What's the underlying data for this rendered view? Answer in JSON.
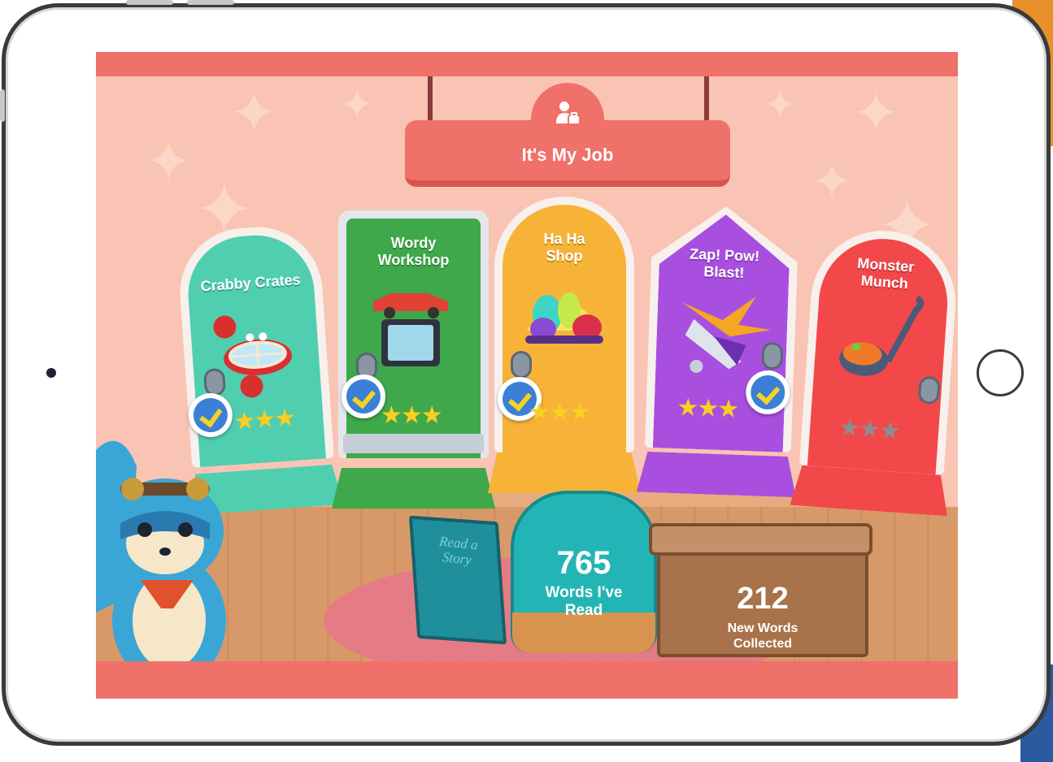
{
  "header": {
    "title": "It's My Job",
    "icon": "worker-briefcase-icon"
  },
  "doors": [
    {
      "id": "crabby-crates",
      "label_lines": [
        "Crabby Crates"
      ],
      "color": "#4fcfb0",
      "completed": true,
      "stars": 3,
      "stars_max": 3,
      "art": "crab-icon"
    },
    {
      "id": "wordy-workshop",
      "label_lines": [
        "Wordy",
        "Workshop"
      ],
      "color": "#3ea84a",
      "completed": true,
      "stars": 3,
      "stars_max": 3,
      "art": "car-tablet-icon"
    },
    {
      "id": "ha-ha-shop",
      "label_lines": [
        "Ha Ha",
        "Shop"
      ],
      "color": "#f7b338",
      "completed": true,
      "stars": 3,
      "stars_max": 3,
      "art": "jelly-characters-icon"
    },
    {
      "id": "zap-pow-blast",
      "label_lines": [
        "Zap! Pow!",
        "Blast!"
      ],
      "color": "#a84fe0",
      "completed": true,
      "stars": 3,
      "stars_max": 3,
      "art": "rocket-icon"
    },
    {
      "id": "monster-munch",
      "label_lines": [
        "Monster",
        "Munch"
      ],
      "color": "#f2484a",
      "completed": false,
      "stars": 0,
      "stars_max": 3,
      "art": "ladle-icon"
    }
  ],
  "book": {
    "label": "Read a Story"
  },
  "backpack": {
    "count": "765",
    "label_lines": [
      "Words I've",
      "Read"
    ]
  },
  "chest": {
    "count": "212",
    "label_lines": [
      "New Words",
      "Collected"
    ]
  },
  "colors": {
    "banner": "#f0706a",
    "wall": "#f9c4b3",
    "check": "#3b80d6",
    "star": "#f8cf22"
  }
}
